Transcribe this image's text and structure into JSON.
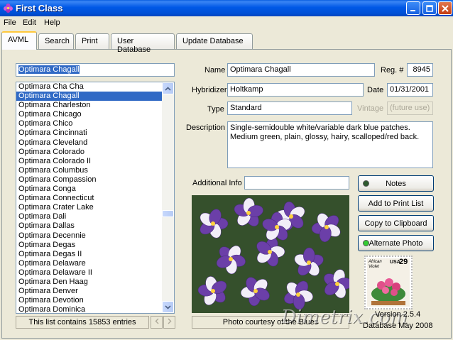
{
  "window": {
    "title": "First Class"
  },
  "menu": [
    "File",
    "Edit",
    "Help"
  ],
  "tabs": [
    "AVML",
    "Search",
    "Print",
    "User Database",
    "Update Database"
  ],
  "search": {
    "value": "Optimara Chagall"
  },
  "list": {
    "items": [
      "Optimara Cha Cha",
      "Optimara Chagall",
      "Optimara Charleston",
      "Optimara Chicago",
      "Optimara Chico",
      "Optimara Cincinnati",
      "Optimara Cleveland",
      "Optimara Colorado",
      "Optimara Colorado II",
      "Optimara Columbus",
      "Optimara Compassion",
      "Optimara Conga",
      "Optimara Connecticut",
      "Optimara Crater Lake",
      "Optimara Dali",
      "Optimara Dallas",
      "Optimara Decennie",
      "Optimara Degas",
      "Optimara Degas II",
      "Optimara Delaware",
      "Optimara Delaware II",
      "Optimara Den Haag",
      "Optimara Denver",
      "Optimara Devotion",
      "Optimara Dominica"
    ],
    "selected_index": 1,
    "status": "This list contains 15853 entries"
  },
  "details": {
    "name_label": "Name",
    "name": "Optimara Chagall",
    "reg_label": "Reg. #",
    "reg": "8945",
    "hybridizer_label": "Hybridizer",
    "hybridizer": "Holtkamp",
    "date_label": "Date",
    "date": "01/31/2001",
    "type_label": "Type",
    "type": "Standard",
    "vintage_label": "Vintage",
    "vintage": "(future use)",
    "description_label": "Description",
    "description": "Single-semidouble white/variable dark blue patches. Medium green, plain, glossy, hairy, scalloped/red back.",
    "additional_label": "Additional Info",
    "additional": ""
  },
  "buttons": {
    "notes": "Notes",
    "add_print": "Add to Print List",
    "copy": "Copy to Clipboard",
    "alt_photo": "Alternate Photo"
  },
  "photo": {
    "credit": "Photo courtesy of the Blues"
  },
  "stamp": {
    "title": "African Violet",
    "country": "USA",
    "value": "29"
  },
  "watermark": "Dimetrix.com",
  "version": {
    "line1": "Version 2.5.4",
    "line2": "Database May 2008"
  },
  "colors": {
    "titlebar": "#0058e6",
    "selection": "#316ac5",
    "led_off": "#2d5a2d",
    "led_on": "#33cc33"
  }
}
